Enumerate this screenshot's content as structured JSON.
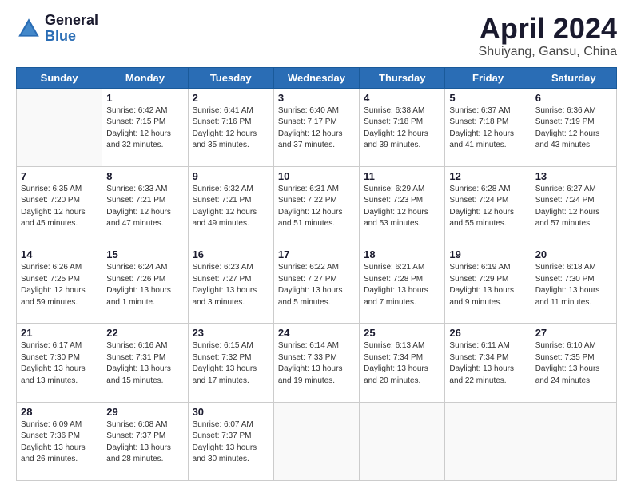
{
  "header": {
    "logo_general": "General",
    "logo_blue": "Blue",
    "month_title": "April 2024",
    "subtitle": "Shuiyang, Gansu, China"
  },
  "days_of_week": [
    "Sunday",
    "Monday",
    "Tuesday",
    "Wednesday",
    "Thursday",
    "Friday",
    "Saturday"
  ],
  "weeks": [
    [
      {
        "day": "",
        "info": ""
      },
      {
        "day": "1",
        "info": "Sunrise: 6:42 AM\nSunset: 7:15 PM\nDaylight: 12 hours\nand 32 minutes."
      },
      {
        "day": "2",
        "info": "Sunrise: 6:41 AM\nSunset: 7:16 PM\nDaylight: 12 hours\nand 35 minutes."
      },
      {
        "day": "3",
        "info": "Sunrise: 6:40 AM\nSunset: 7:17 PM\nDaylight: 12 hours\nand 37 minutes."
      },
      {
        "day": "4",
        "info": "Sunrise: 6:38 AM\nSunset: 7:18 PM\nDaylight: 12 hours\nand 39 minutes."
      },
      {
        "day": "5",
        "info": "Sunrise: 6:37 AM\nSunset: 7:18 PM\nDaylight: 12 hours\nand 41 minutes."
      },
      {
        "day": "6",
        "info": "Sunrise: 6:36 AM\nSunset: 7:19 PM\nDaylight: 12 hours\nand 43 minutes."
      }
    ],
    [
      {
        "day": "7",
        "info": "Sunrise: 6:35 AM\nSunset: 7:20 PM\nDaylight: 12 hours\nand 45 minutes."
      },
      {
        "day": "8",
        "info": "Sunrise: 6:33 AM\nSunset: 7:21 PM\nDaylight: 12 hours\nand 47 minutes."
      },
      {
        "day": "9",
        "info": "Sunrise: 6:32 AM\nSunset: 7:21 PM\nDaylight: 12 hours\nand 49 minutes."
      },
      {
        "day": "10",
        "info": "Sunrise: 6:31 AM\nSunset: 7:22 PM\nDaylight: 12 hours\nand 51 minutes."
      },
      {
        "day": "11",
        "info": "Sunrise: 6:29 AM\nSunset: 7:23 PM\nDaylight: 12 hours\nand 53 minutes."
      },
      {
        "day": "12",
        "info": "Sunrise: 6:28 AM\nSunset: 7:24 PM\nDaylight: 12 hours\nand 55 minutes."
      },
      {
        "day": "13",
        "info": "Sunrise: 6:27 AM\nSunset: 7:24 PM\nDaylight: 12 hours\nand 57 minutes."
      }
    ],
    [
      {
        "day": "14",
        "info": "Sunrise: 6:26 AM\nSunset: 7:25 PM\nDaylight: 12 hours\nand 59 minutes."
      },
      {
        "day": "15",
        "info": "Sunrise: 6:24 AM\nSunset: 7:26 PM\nDaylight: 13 hours\nand 1 minute."
      },
      {
        "day": "16",
        "info": "Sunrise: 6:23 AM\nSunset: 7:27 PM\nDaylight: 13 hours\nand 3 minutes."
      },
      {
        "day": "17",
        "info": "Sunrise: 6:22 AM\nSunset: 7:27 PM\nDaylight: 13 hours\nand 5 minutes."
      },
      {
        "day": "18",
        "info": "Sunrise: 6:21 AM\nSunset: 7:28 PM\nDaylight: 13 hours\nand 7 minutes."
      },
      {
        "day": "19",
        "info": "Sunrise: 6:19 AM\nSunset: 7:29 PM\nDaylight: 13 hours\nand 9 minutes."
      },
      {
        "day": "20",
        "info": "Sunrise: 6:18 AM\nSunset: 7:30 PM\nDaylight: 13 hours\nand 11 minutes."
      }
    ],
    [
      {
        "day": "21",
        "info": "Sunrise: 6:17 AM\nSunset: 7:30 PM\nDaylight: 13 hours\nand 13 minutes."
      },
      {
        "day": "22",
        "info": "Sunrise: 6:16 AM\nSunset: 7:31 PM\nDaylight: 13 hours\nand 15 minutes."
      },
      {
        "day": "23",
        "info": "Sunrise: 6:15 AM\nSunset: 7:32 PM\nDaylight: 13 hours\nand 17 minutes."
      },
      {
        "day": "24",
        "info": "Sunrise: 6:14 AM\nSunset: 7:33 PM\nDaylight: 13 hours\nand 19 minutes."
      },
      {
        "day": "25",
        "info": "Sunrise: 6:13 AM\nSunset: 7:34 PM\nDaylight: 13 hours\nand 20 minutes."
      },
      {
        "day": "26",
        "info": "Sunrise: 6:11 AM\nSunset: 7:34 PM\nDaylight: 13 hours\nand 22 minutes."
      },
      {
        "day": "27",
        "info": "Sunrise: 6:10 AM\nSunset: 7:35 PM\nDaylight: 13 hours\nand 24 minutes."
      }
    ],
    [
      {
        "day": "28",
        "info": "Sunrise: 6:09 AM\nSunset: 7:36 PM\nDaylight: 13 hours\nand 26 minutes."
      },
      {
        "day": "29",
        "info": "Sunrise: 6:08 AM\nSunset: 7:37 PM\nDaylight: 13 hours\nand 28 minutes."
      },
      {
        "day": "30",
        "info": "Sunrise: 6:07 AM\nSunset: 7:37 PM\nDaylight: 13 hours\nand 30 minutes."
      },
      {
        "day": "",
        "info": ""
      },
      {
        "day": "",
        "info": ""
      },
      {
        "day": "",
        "info": ""
      },
      {
        "day": "",
        "info": ""
      }
    ]
  ]
}
